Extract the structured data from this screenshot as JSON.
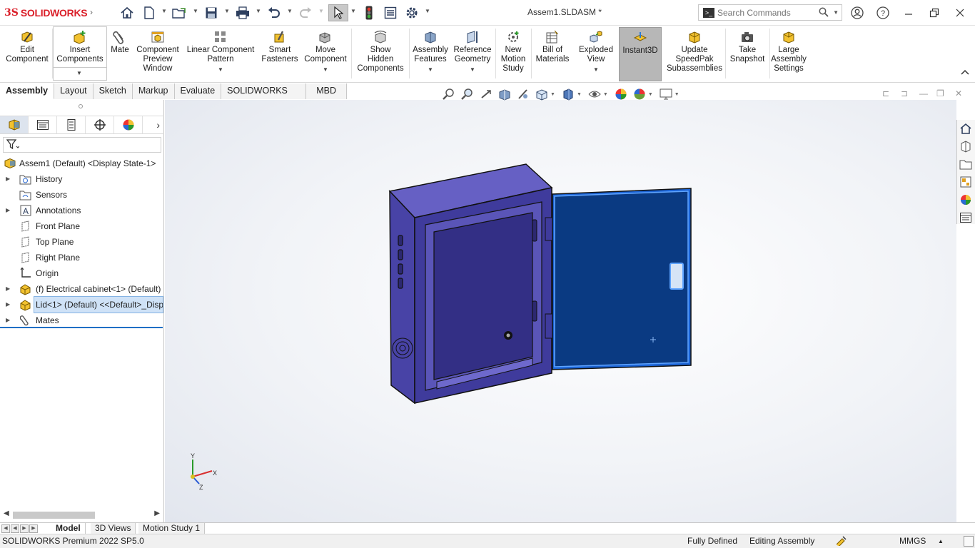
{
  "app": {
    "brand_ds": "3S",
    "brand_name": "SOLIDWORKS",
    "doc_title": "Assem1.SLDASM *"
  },
  "search": {
    "placeholder": "Search Commands"
  },
  "ribbon": {
    "buttons": [
      {
        "label": "Edit\nComponent",
        "icon": "edit-component-icon"
      },
      {
        "label": "Insert\nComponents",
        "icon": "insert-components-icon"
      },
      {
        "label": "Mate",
        "icon": "mate-icon"
      },
      {
        "label": "Component\nPreview\nWindow",
        "icon": "preview-window-icon"
      },
      {
        "label": "Linear Component\nPattern",
        "icon": "linear-pattern-icon"
      },
      {
        "label": "Smart\nFasteners",
        "icon": "smart-fasteners-icon"
      },
      {
        "label": "Move\nComponent",
        "icon": "move-component-icon"
      },
      {
        "label": "Show\nHidden\nComponents",
        "icon": "show-hidden-icon"
      },
      {
        "label": "Assembly\nFeatures",
        "icon": "assembly-features-icon"
      },
      {
        "label": "Reference\nGeometry",
        "icon": "reference-geometry-icon"
      },
      {
        "label": "New\nMotion\nStudy",
        "icon": "motion-study-icon"
      },
      {
        "label": "Bill of\nMaterials",
        "icon": "bom-icon"
      },
      {
        "label": "Exploded\nView",
        "icon": "exploded-view-icon"
      },
      {
        "label": "Instant3D",
        "icon": "instant3d-icon"
      },
      {
        "label": "Update\nSpeedPak\nSubassemblies",
        "icon": "speedpak-icon"
      },
      {
        "label": "Take\nSnapshot",
        "icon": "camera-icon"
      },
      {
        "label": "Large\nAssembly\nSettings",
        "icon": "large-assembly-icon"
      }
    ]
  },
  "tabs": [
    "Assembly",
    "Layout",
    "Sketch",
    "Markup",
    "Evaluate",
    "SOLIDWORKS Add-Ins",
    "MBD"
  ],
  "tree": {
    "root": "Assem1 (Default) <Display State-1>",
    "items": [
      {
        "label": "History",
        "icon": "history-folder-icon"
      },
      {
        "label": "Sensors",
        "icon": "sensors-folder-icon"
      },
      {
        "label": "Annotations",
        "icon": "annotations-icon"
      },
      {
        "label": "Front Plane",
        "icon": "plane-icon"
      },
      {
        "label": "Top Plane",
        "icon": "plane-icon"
      },
      {
        "label": "Right Plane",
        "icon": "plane-icon"
      },
      {
        "label": "Origin",
        "icon": "origin-icon"
      },
      {
        "label": "(f) Electrical cabinet<1> (Default)",
        "icon": "part-icon"
      },
      {
        "label": "Lid<1> (Default) <<Default>_Disp",
        "icon": "part-icon"
      },
      {
        "label": "Mates",
        "icon": "mates-icon"
      }
    ]
  },
  "triad": {
    "x": "X",
    "y": "Y",
    "z": "Z"
  },
  "bottom_tabs": [
    "Model",
    "3D Views",
    "Motion Study 1"
  ],
  "status": {
    "edition": "SOLIDWORKS Premium 2022 SP5.0",
    "state": "Fully Defined",
    "mode": "Editing Assembly",
    "units": "MMGS"
  },
  "colors": {
    "accent": "#1f6fc5",
    "cabinet": "#4a45a8",
    "lid": "#0a3a82",
    "brand": "#da1e28"
  }
}
